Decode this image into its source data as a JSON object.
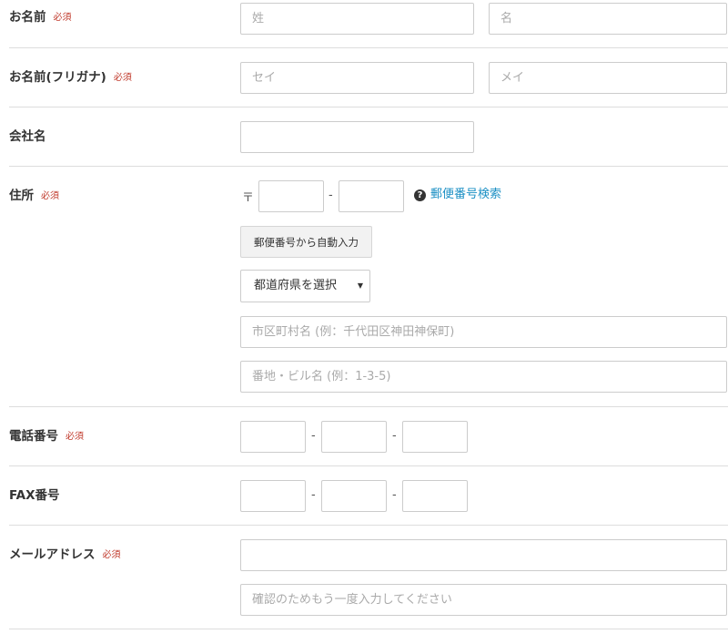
{
  "name": {
    "label": "お名前",
    "required": "必須",
    "last_placeholder": "姓",
    "first_placeholder": "名"
  },
  "kana": {
    "label": "お名前(フリガナ)",
    "required": "必須",
    "last_placeholder": "セイ",
    "first_placeholder": "メイ"
  },
  "company": {
    "label": "会社名"
  },
  "address": {
    "label": "住所",
    "required": "必須",
    "zip_mark": "〒",
    "zip_dash": "-",
    "zip_search_link": "郵便番号検索",
    "zip_help_icon": "?",
    "autofill_button": "郵便番号から自動入力",
    "prefecture_select": "都道府県を選択",
    "prefecture_caret": "▼",
    "city_placeholder": "市区町村名 (例：千代田区神田神保町)",
    "street_placeholder": "番地・ビル名 (例：1-3-5)"
  },
  "phone": {
    "label": "電話番号",
    "required": "必須",
    "dash1": "-",
    "dash2": "-"
  },
  "fax": {
    "label": "FAX番号",
    "dash1": "-",
    "dash2": "-"
  },
  "email": {
    "label": "メールアドレス",
    "required": "必須",
    "confirm_placeholder": "確認のためもう一度入力してください"
  }
}
